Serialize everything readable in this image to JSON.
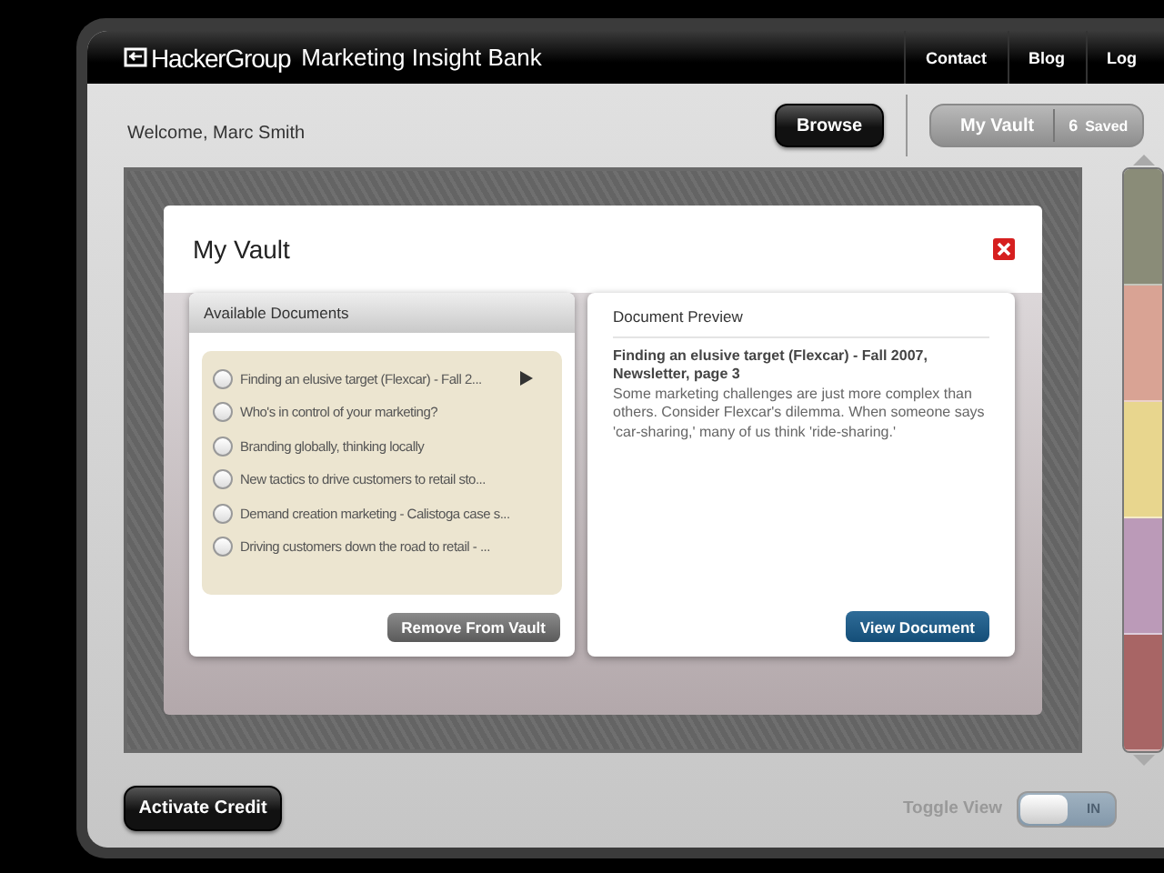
{
  "header": {
    "logo_mark": "HackerGroup",
    "title": "Marketing Insight Bank",
    "nav": [
      "Contact",
      "Blog",
      "Log"
    ]
  },
  "welcome": "Welcome, Marc Smith",
  "browse_button": "Browse",
  "vault_tab": {
    "label": "My Vault",
    "count": "6",
    "count_label": "Saved"
  },
  "modal": {
    "title": "My Vault",
    "available": {
      "title": "Available Documents",
      "items": [
        {
          "label": "Finding an elusive target (Flexcar) - Fall 2...",
          "checked": false,
          "selected": true
        },
        {
          "label": "Who's in control of your marketing?",
          "checked": false,
          "selected": false
        },
        {
          "label": "Branding globally, thinking locally",
          "checked": false,
          "selected": false
        },
        {
          "label": "New tactics to drive customers to retail sto...",
          "checked": false,
          "selected": false
        },
        {
          "label": "Demand creation marketing - Calistoga case s...",
          "checked": false,
          "selected": false
        },
        {
          "label": "Driving customers down the road to retail - ...",
          "checked": false,
          "selected": false
        }
      ],
      "button": "Remove From Vault"
    },
    "preview": {
      "title": "Document Preview",
      "heading": "Finding an elusive target (Flexcar) - Fall 2007, Newsletter, page 3",
      "body": "Some marketing challenges are just more complex than others. Consider Flexcar's dilemma. When someone says 'car-sharing,' many of us think 'ride-sharing.'",
      "button": "View Document"
    }
  },
  "swatches": [
    {
      "color": "#8a8c78"
    },
    {
      "color": "#d9a394"
    },
    {
      "color": "#e8d68e"
    },
    {
      "color": "#bb9ab8"
    },
    {
      "color": "#a86565"
    }
  ],
  "activate_button": "Activate Credit",
  "toggle": {
    "label": "Toggle View",
    "state_label": "IN",
    "on": true
  }
}
